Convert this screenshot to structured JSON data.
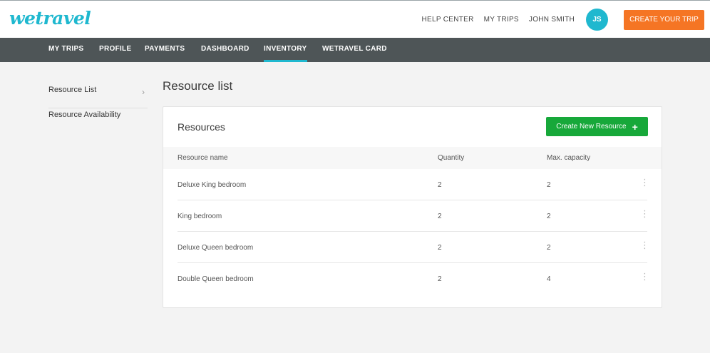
{
  "header": {
    "logo": "wetravel",
    "links": [
      "HELP CENTER",
      "MY TRIPS",
      "JOHN SMITH"
    ],
    "avatar_initials": "JS",
    "cta_label": "CREATE YOUR TRIP"
  },
  "nav": {
    "items": [
      "MY TRIPS",
      "PROFILE",
      "PAYMENTS",
      "DASHBOARD",
      "INVENTORY",
      "WETRAVEL CARD"
    ],
    "active": "INVENTORY"
  },
  "sidebar": {
    "items": [
      "Resource List",
      "Resource Availability"
    ],
    "active": "Resource List"
  },
  "main": {
    "title": "Resource list",
    "card_title": "Resources",
    "create_button": "Create New Resource",
    "columns": [
      "Resource name",
      "Quantity",
      "Max. capacity"
    ],
    "rows": [
      {
        "name": "Deluxe King bedroom",
        "quantity": "2",
        "capacity": "2"
      },
      {
        "name": "King bedroom",
        "quantity": "2",
        "capacity": "2"
      },
      {
        "name": "Deluxe Queen bedroom",
        "quantity": "2",
        "capacity": "2"
      },
      {
        "name": "Double Queen bedroom",
        "quantity": "2",
        "capacity": "4"
      }
    ]
  },
  "icons": {
    "sidebar_chevron": "chevron-right-icon",
    "create_plus": "plus-icon",
    "row_menu": "kebab-menu-icon"
  },
  "colors": {
    "brand": "#1fb8cf",
    "cta": "#f57524",
    "nav_bg": "#4e5557",
    "create_button": "#17a83a"
  }
}
